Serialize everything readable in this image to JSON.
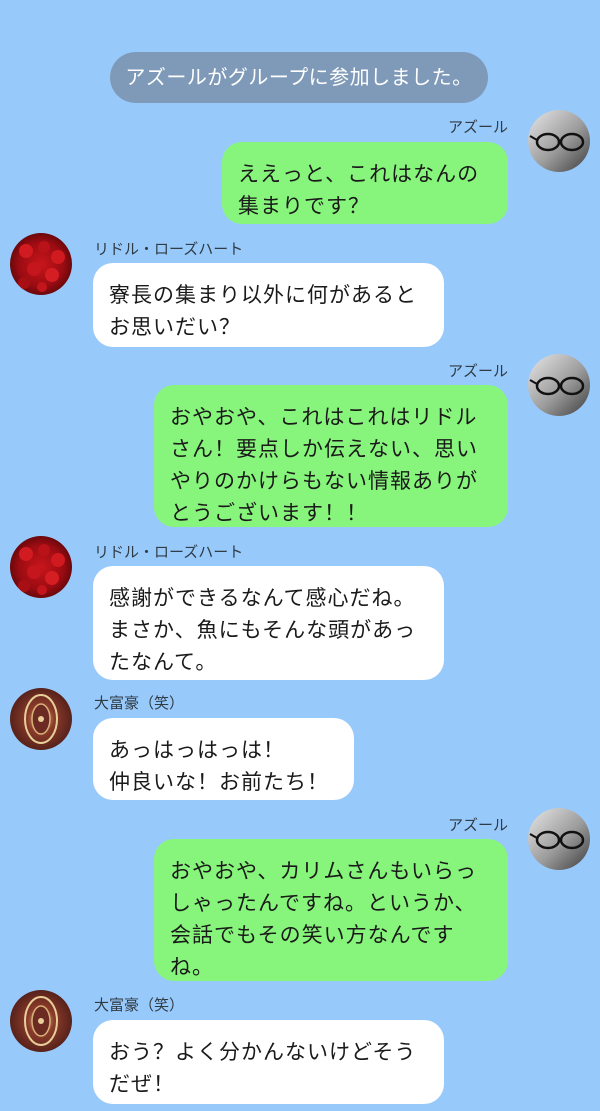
{
  "colors": {
    "background": "#98c9fb",
    "system_notice_bg": "#7f9ab8",
    "outgoing_bubble": "#87f57b",
    "incoming_bubble": "#ffffff"
  },
  "system_notice": "アズールがグループに参加しました。",
  "messages": [
    {
      "sender": "アズール",
      "direction": "outgoing",
      "avatar_icon": "glasses-avatar-icon",
      "lines": [
        "ええっと、これはなんの",
        "集まりです？"
      ]
    },
    {
      "sender": "リドル・ローズハート",
      "direction": "incoming",
      "avatar_icon": "roses-avatar-icon",
      "lines": [
        "寮長の集まり以外に何があると",
        "お思いだい？"
      ]
    },
    {
      "sender": "アズール",
      "direction": "outgoing",
      "avatar_icon": "glasses-avatar-icon",
      "lines": [
        "おやおや、これはこれはリドル",
        "さん！要点しか伝えない、思い",
        "やりのかけらもない情報ありが",
        "とうございます！！"
      ]
    },
    {
      "sender": "リドル・ローズハート",
      "direction": "incoming",
      "avatar_icon": "roses-avatar-icon",
      "lines": [
        "感謝ができるなんて感心だね。",
        "まさか、魚にもそんな頭があっ",
        "たなんて。"
      ]
    },
    {
      "sender": "大富豪（笑）",
      "direction": "incoming",
      "avatar_icon": "carpet-avatar-icon",
      "lines": [
        "あっはっはっは！",
        "仲良いな！お前たち！"
      ]
    },
    {
      "sender": "アズール",
      "direction": "outgoing",
      "avatar_icon": "glasses-avatar-icon",
      "lines": [
        "おやおや、カリムさんもいらっ",
        "しゃったんですね。というか、",
        "会話でもその笑い方なんです",
        "ね。"
      ]
    },
    {
      "sender": "大富豪（笑）",
      "direction": "incoming",
      "avatar_icon": "carpet-avatar-icon",
      "lines": [
        "おう？よく分かんないけどそう",
        "だぜ！"
      ]
    }
  ]
}
